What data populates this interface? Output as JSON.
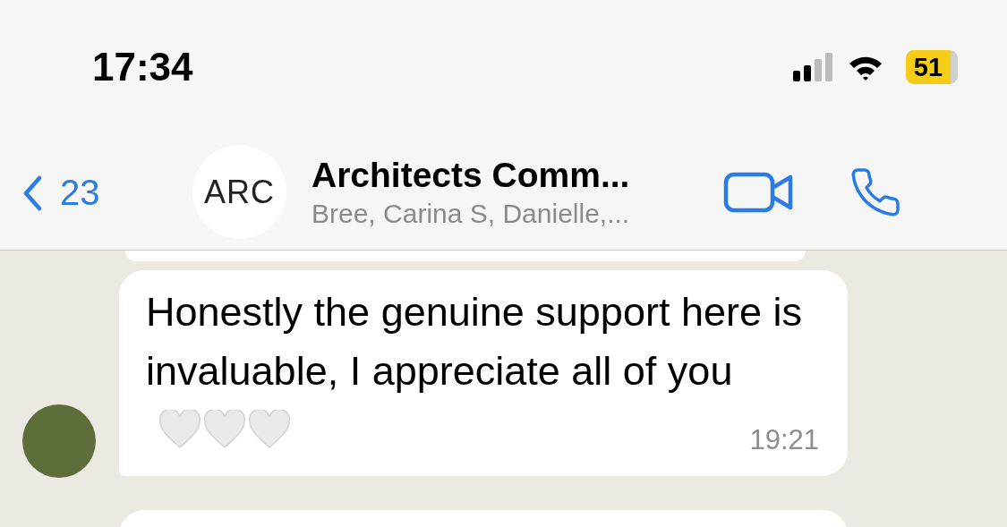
{
  "status_bar": {
    "time": "17:34",
    "battery": "51"
  },
  "header": {
    "back_count": "23",
    "avatar_text": "ARC",
    "title": "Architects Comm...",
    "subtitle": "Bree, Carina S, Danielle,..."
  },
  "messages": [
    {
      "text": "Honestly the genuine support here is invaluable, I appreciate all of you",
      "time": "19:21"
    }
  ]
}
